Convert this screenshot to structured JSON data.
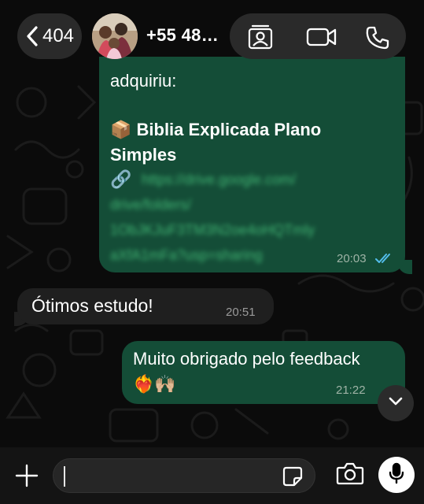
{
  "header": {
    "back_count": "404",
    "contact_name": "+55 48…",
    "icons": [
      "chevron-left-icon",
      "contact-card-icon",
      "video-call-icon",
      "phone-call-icon"
    ]
  },
  "messages": [
    {
      "direction": "outgoing",
      "lines": [
        "adquiriu:",
        "📦 Biblia Explicada Plano",
        "Simples"
      ],
      "link_lines": [
        "https://drive.google.com/",
        "drive/folders/",
        "1ObJKJuF3TM3N2oe4oHQTmly",
        "aXfA1mFa?usp=sharing"
      ],
      "time": "20:03",
      "status": "read"
    },
    {
      "direction": "incoming",
      "text": "Ótimos estudo!",
      "time": "20:51"
    },
    {
      "direction": "outgoing",
      "text": "Muito obrigado pelo feedback",
      "emoji": "❤️‍🔥🙌🏼",
      "time": "21:22"
    }
  ],
  "composer": {
    "input_value": "",
    "icons": [
      "plus-icon",
      "sticker-icon",
      "camera-icon",
      "microphone-icon"
    ]
  },
  "colors": {
    "outgoing_bubble": "#144d37",
    "incoming_bubble": "#1f1f1f",
    "read_ticks": "#53bdeb",
    "background": "#0b0b0b"
  }
}
